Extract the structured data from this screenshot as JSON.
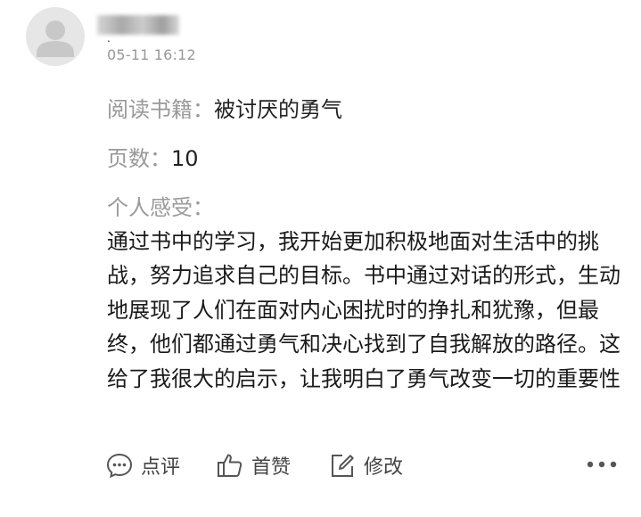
{
  "post": {
    "username": ".",
    "time": "05-11 16:12",
    "book_label": "阅读书籍：",
    "book_value": "被讨厌的勇气",
    "pages_label": "页数：",
    "pages_value": "10",
    "feeling_label": "个人感受：",
    "feeling_text": "通过书中的学习，我开始更加积极地面对生活中的挑战，努力追求自己的目标。书中通过对话的形式，生动地展现了人们在面对内心困扰时的挣扎和犹豫，但最终，他们都通过勇气和决心找到了自我解放的路径。这给了我很大的启示，让我明白了勇气改变一切的重要性"
  },
  "actions": {
    "comment_label": "点评",
    "like_label": "首赞",
    "edit_label": "修改",
    "comment_icon": "comment-icon",
    "like_icon": "thumbs-up-icon",
    "edit_icon": "edit-icon",
    "more_icon": "more-icon"
  },
  "colors": {
    "secondary_text": "#999999",
    "body_text": "#1a1a1a",
    "icon": "#555555"
  }
}
